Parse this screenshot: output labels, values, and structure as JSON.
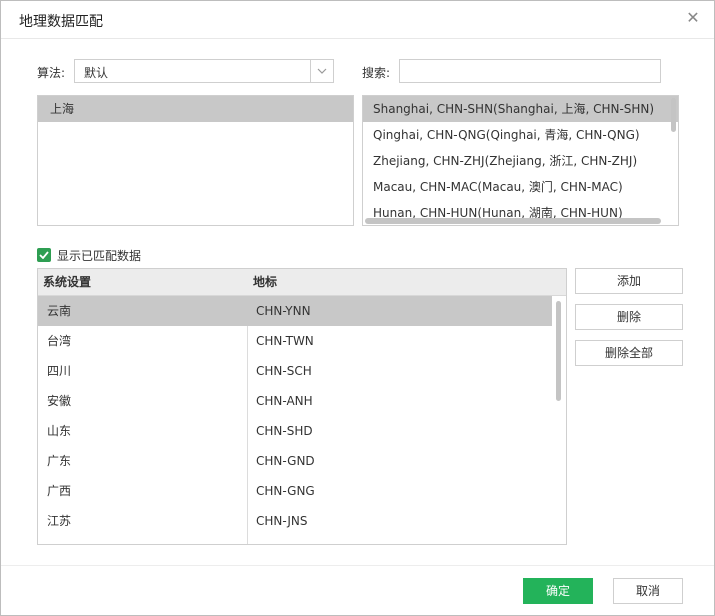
{
  "dialog": {
    "title": "地理数据匹配",
    "close_icon": "close-icon"
  },
  "algorithm": {
    "label": "算法:",
    "value": "默认"
  },
  "search": {
    "label": "搜索:",
    "value": "",
    "placeholder": ""
  },
  "left_list": {
    "items": [
      "上海"
    ],
    "selected_index": 0
  },
  "right_list": {
    "items": [
      "Shanghai, CHN-SHN(Shanghai, 上海, CHN-SHN)",
      "Qinghai, CHN-QNG(Qinghai, 青海, CHN-QNG)",
      "Zhejiang, CHN-ZHJ(Zhejiang, 浙江, CHN-ZHJ)",
      "Macau, CHN-MAC(Macau, 澳门, CHN-MAC)",
      "Hunan, CHN-HUN(Hunan, 湖南, CHN-HUN)"
    ],
    "selected_index": 0
  },
  "show_matched": {
    "label": "显示已匹配数据",
    "checked": true
  },
  "table": {
    "headers": [
      "系统设置",
      "地标"
    ],
    "rows": [
      [
        "云南",
        "CHN-YNN"
      ],
      [
        "台湾",
        "CHN-TWN"
      ],
      [
        "四川",
        "CHN-SCH"
      ],
      [
        "安徽",
        "CHN-ANH"
      ],
      [
        "山东",
        "CHN-SHD"
      ],
      [
        "广东",
        "CHN-GND"
      ],
      [
        "广西",
        "CHN-GNG"
      ],
      [
        "江苏",
        "CHN-JNS"
      ]
    ],
    "selected_row": 0
  },
  "side_buttons": {
    "add": "添加",
    "delete": "删除",
    "delete_all": "删除全部"
  },
  "footer": {
    "ok": "确定",
    "cancel": "取消"
  },
  "colors": {
    "primary": "#23b35a",
    "checkbox": "#2e9e52",
    "selection": "#c8c8c8"
  }
}
